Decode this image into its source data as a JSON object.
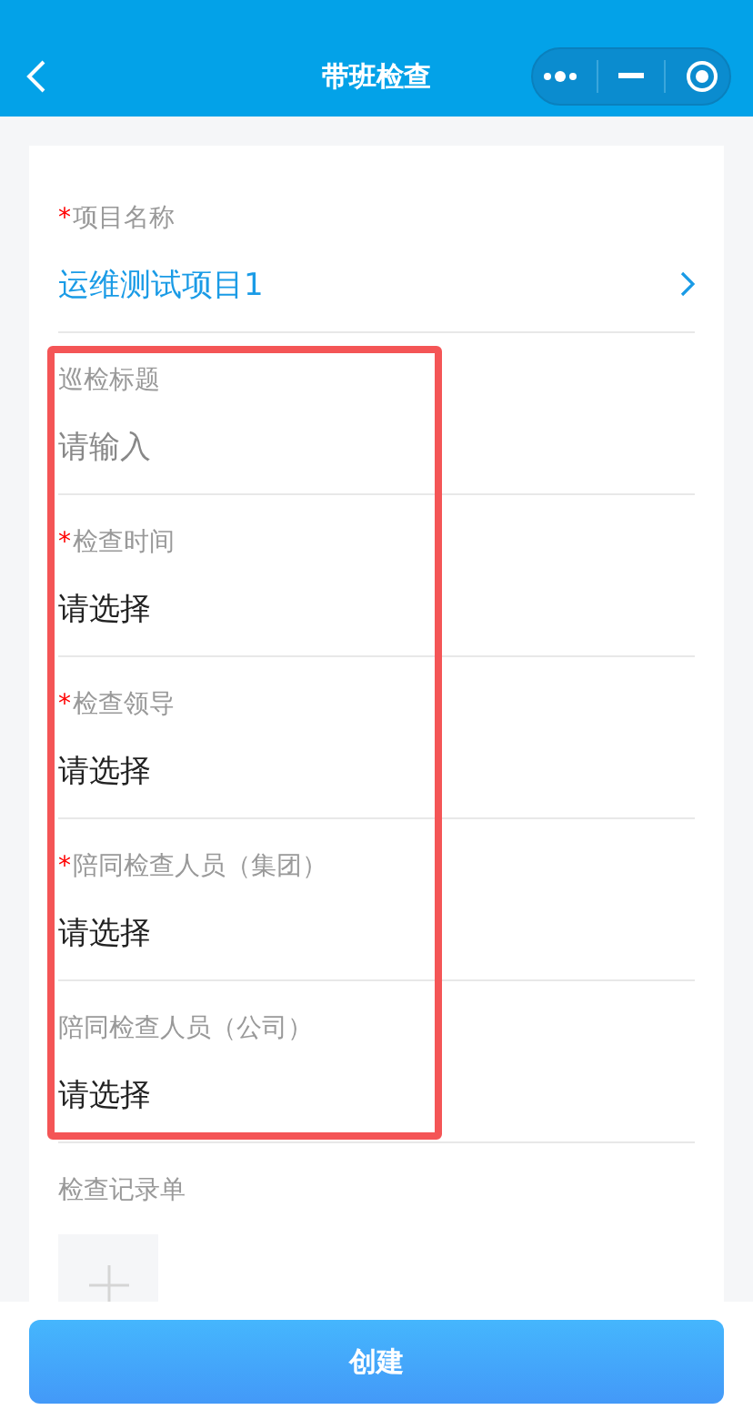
{
  "nav_bar": {
    "title": "带班检查"
  },
  "form": {
    "fields": [
      {
        "kind": "picker",
        "required_mark": "*",
        "label": "项目名称",
        "value": "运维测试项目1"
      },
      {
        "kind": "input",
        "label": "巡检标题",
        "placeholder": "请输入"
      },
      {
        "kind": "picker",
        "required_mark": "*",
        "label": "检查时间",
        "placeholder": "请选择"
      },
      {
        "kind": "picker",
        "required_mark": "*",
        "label": "检查领导",
        "placeholder": "请选择"
      },
      {
        "kind": "picker",
        "required_mark": "*",
        "label": "陪同检查人员（集团）",
        "placeholder": "请选择"
      },
      {
        "kind": "picker",
        "label": "陪同检查人员（公司）",
        "placeholder": "请选择"
      }
    ],
    "upload": {
      "label": "检查记录单"
    }
  },
  "footer": {
    "button": "创建"
  }
}
